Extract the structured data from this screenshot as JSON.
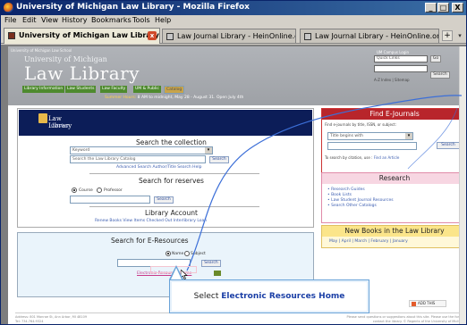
{
  "window": {
    "title": "University of Michigan Law Library - Mozilla Firefox",
    "controls": [
      "_",
      "□",
      "X"
    ]
  },
  "menu": [
    "File",
    "Edit",
    "View",
    "History",
    "Bookmarks",
    "Tools",
    "Help"
  ],
  "tabs": [
    {
      "label": "University of Michigan Law Library",
      "active": true
    },
    {
      "label": "Law Journal Library - HeinOnline.org",
      "active": false
    },
    {
      "label": "Law Journal Library - HeinOnline.org",
      "active": false
    }
  ],
  "page": {
    "university_tag": "University of Michigan Law School",
    "logo_line1": "University of Michigan",
    "logo_line2": "Law Library",
    "nav": [
      "Library Information",
      "Law Students",
      "Law Faculty",
      "UM & Public",
      "Catalog"
    ],
    "hours_prefix": "Summer Hours:",
    "hours_text": "8 AM to midnight, May 28 - August 31. Open July 4th",
    "header_search_label": "UM Campus Login",
    "header_select": "Quick Links",
    "header_go": "Go",
    "header_search_btn": "Search",
    "header_links": "A-Z Index | Sitemap",
    "catalog_logo_line1": "Law Library",
    "catalog_logo_line2": "Catalog",
    "search_collection": {
      "title": "Search the collection",
      "select": "Keyword",
      "input": "Search the Law Library Catalog",
      "button": "Search",
      "links": "Advanced Search   Author/Title Search   Help"
    },
    "search_reserves": {
      "title": "Search for reserves",
      "radio1": "Course",
      "radio2": "Professor",
      "button": "Search"
    },
    "library_account": {
      "title": "Library Account",
      "links": "Renew Books   View Items Checked Out   Interlibrary Loan"
    },
    "e_resources": {
      "title": "Search for E-Resources",
      "radio1": "Name",
      "radio2": "Subject",
      "button": "Search",
      "home_link": "Electronic Resources Home"
    },
    "ejournals": {
      "title": "Find E-Journals",
      "desc": "Find e-journals by title, ISSN, or subject:",
      "select": "Title begins with",
      "button": "Search",
      "citation": "To search by citation, use :",
      "citation_link": "Find an Article"
    },
    "research": {
      "title": "Research",
      "items": [
        "Research Guides",
        "Book Lists",
        "Law Student Journal Resources",
        "Search Other Catalogs"
      ]
    },
    "new_books": {
      "title": "New Books in the Law Library",
      "links": "May | April | March | February | January"
    },
    "footer_left": "Address: 801 Monroe St, Ann Arbor, MI 48109\nTel: 734.764.9324",
    "footer_right": "Please send questions or suggestions about this site. Please use the form to contact the library. © Regents of the University of Michigan",
    "share": "ADD THIS"
  },
  "callout": {
    "prefix": "Select ",
    "target": "Electronic Resources Home"
  }
}
